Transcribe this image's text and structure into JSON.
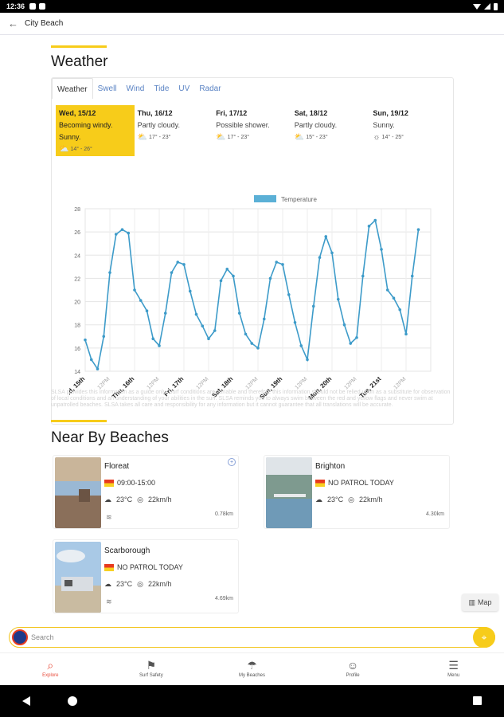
{
  "status": {
    "time": "12:36"
  },
  "appbar": {
    "title": "City Beach"
  },
  "weather": {
    "title": "Weather",
    "tabs": [
      "Weather",
      "Swell",
      "Wind",
      "Tide",
      "UV",
      "Radar"
    ],
    "days": [
      {
        "name": "Wed, 15/12",
        "desc": "Becoming windy.",
        "desc2": "Sunny.",
        "range": "14° - 26°",
        "icon": "sun-cloud-icon"
      },
      {
        "name": "Thu, 16/12",
        "desc": "Partly cloudy.",
        "desc2": "",
        "range": "17° - 23°",
        "icon": "partly-cloudy-icon"
      },
      {
        "name": "Fri, 17/12",
        "desc": "Possible shower.",
        "desc2": "",
        "range": "17° - 23°",
        "icon": "partly-cloudy-icon"
      },
      {
        "name": "Sat, 18/12",
        "desc": "Partly cloudy.",
        "desc2": "",
        "range": "15° - 23°",
        "icon": "partly-cloudy-icon"
      },
      {
        "name": "Sun, 19/12",
        "desc": "Sunny.",
        "desc2": "",
        "range": "14° - 25°",
        "icon": "sun-icon"
      }
    ],
    "disclaimer": "SLSA provides this information as a guide only. Surf conditions are variable and therefore this information should not be relied upon as a substitute for observation of local conditions and an understanding of your abilities in the surf. SLSA reminds you to always swim between the red and yellow flags and never swim at unpatrolled beaches. SLSA takes all care and responsibility for any information but it cannot guarantee that all translations will be accurate."
  },
  "chart_data": {
    "type": "line",
    "legend": "Temperature",
    "series": [
      {
        "name": "Temperature",
        "x": [
          0,
          0.125,
          0.25,
          0.375,
          0.5,
          0.625,
          0.75,
          0.875,
          1,
          1.125,
          1.25,
          1.375,
          1.5,
          1.625,
          1.75,
          1.875,
          2,
          2.125,
          2.25,
          2.375,
          2.5,
          2.625,
          2.75,
          2.875,
          3,
          3.125,
          3.25,
          3.375,
          3.5,
          3.625,
          3.75,
          3.875,
          4,
          4.125,
          4.25,
          4.375,
          4.5,
          4.625,
          4.75,
          4.875,
          5,
          5.125,
          5.25,
          5.375,
          5.5,
          5.625,
          5.75,
          5.875,
          6,
          6.125,
          6.25,
          6.375,
          6.5,
          6.625,
          6.75
        ],
        "values": [
          16.7,
          15,
          14.2,
          17,
          22.5,
          25.8,
          26.2,
          25.9,
          21,
          20.1,
          19.2,
          16.8,
          16.2,
          19,
          22.5,
          23.4,
          23.2,
          20.9,
          18.9,
          17.9,
          16.8,
          17.5,
          21.8,
          22.8,
          22.2,
          19,
          17.2,
          16.4,
          16,
          18.5,
          22,
          23.4,
          23.2,
          20.6,
          18.2,
          16.2,
          15,
          19.6,
          23.8,
          25.6,
          24.2,
          20.2,
          18,
          16.4,
          16.9,
          22.2,
          26.5,
          27,
          24.5,
          21,
          20.3,
          19.3,
          17.2,
          22.2,
          26.2
        ]
      }
    ],
    "ylim": [
      14,
      28
    ],
    "yticks": [
      14,
      16,
      18,
      20,
      22,
      24,
      26,
      28
    ],
    "xticks": [
      "Wed, 15th",
      "12PM",
      "Thu, 16th",
      "12PM",
      "Fri, 17th",
      "12PM",
      "Sat, 18th",
      "12PM",
      "Sun, 19th",
      "12PM",
      "Mon, 20th",
      "12PM",
      "Tue, 21st",
      "12PM"
    ],
    "grid": true,
    "legend_position": "top-center"
  },
  "nearby": {
    "title": "Near By Beaches",
    "beaches": [
      {
        "name": "Floreat",
        "patrol": "09:00-15:00",
        "temp": "23°C",
        "wind": "22km/h",
        "distance": "0.78km",
        "favorite": true
      },
      {
        "name": "Brighton",
        "patrol": "NO PATROL TODAY",
        "temp": "23°C",
        "wind": "22km/h",
        "distance": "4.30km",
        "favorite": false
      },
      {
        "name": "Scarborough",
        "patrol": "NO PATROL TODAY",
        "temp": "23°C",
        "wind": "22km/h",
        "distance": "4.69km",
        "favorite": false
      }
    ],
    "map_label": "Map"
  },
  "search": {
    "placeholder": "Search"
  },
  "nav": [
    "Explore",
    "Surf Safety",
    "My Beaches",
    "Profile",
    "Menu"
  ],
  "colors": {
    "accent": "#f7cc1a",
    "link": "#5a83c4",
    "line": "#3d9bc9",
    "nav_active": "#e84b3a"
  }
}
